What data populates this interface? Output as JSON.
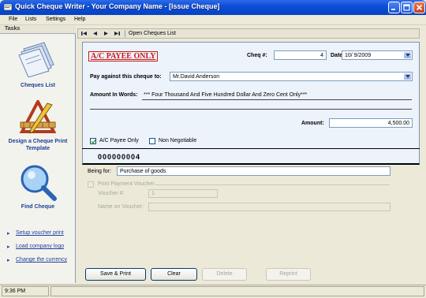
{
  "window": {
    "title": "Quick Cheque Writer - Your Company Name - [Issue Cheque]"
  },
  "menu": [
    "File",
    "Lists",
    "Settings",
    "Help"
  ],
  "sidebar": {
    "title": "Tasks",
    "tasks": [
      {
        "label": "Cheques List",
        "icon": "cheques-list-icon"
      },
      {
        "label": "Design a Cheque Print Template",
        "icon": "design-template-icon"
      },
      {
        "label": "Find Cheque",
        "icon": "find-cheque-icon"
      }
    ],
    "links": [
      "Setup voucher print",
      "Load company logo",
      "Change the currency"
    ]
  },
  "nav": {
    "label": "Open Cheques List"
  },
  "cheque": {
    "payee_banner": "A/C PAYEE ONLY",
    "cheq_no_label": "Cheq #:",
    "cheq_no": "4",
    "date_label": "Date:",
    "date": "10/ 9/2009",
    "pay_label": "Pay against this cheque to:",
    "payee": "Mr.David Anderson",
    "words_label": "Amount In Words:",
    "words": "*** Four Thousand And Five Hundred Dollar And Zero Cent Only***",
    "amount_label": "Amount:",
    "amount": "4,500.00",
    "ac_payee_label": "A/C Payee Only",
    "ac_payee_checked": true,
    "non_negotiable_label": "Non Negotiable",
    "non_negotiable_checked": false,
    "cheque_number": "000000004"
  },
  "form": {
    "being_for_label": "Being for:",
    "being_for": "Purchase of goods",
    "print_voucher_label": "Print Payment Voucher",
    "voucher_no_label": "Voucher #:",
    "voucher_no": "1",
    "name_on_voucher_label": "Name on Voucher:",
    "name_on_voucher": ""
  },
  "buttons": {
    "save_print": "Save & Print",
    "clear": "Clear",
    "delete": "Delete",
    "reprint": "Reprint"
  },
  "status": {
    "time": "9:36 PM"
  },
  "colors": {
    "titlebar": "#0a4fd8",
    "payee_banner": "#c81818",
    "link": "#1f3f9c",
    "cheque_bg": "#ecf3fb"
  }
}
